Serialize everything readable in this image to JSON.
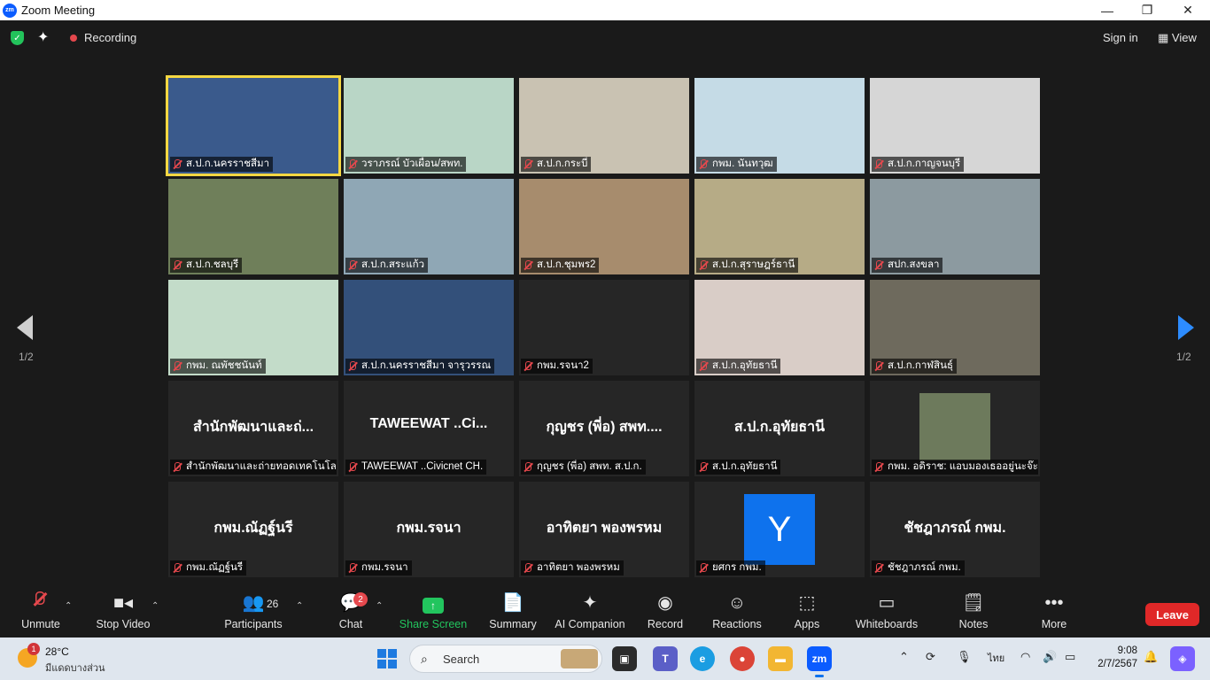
{
  "window": {
    "title": "Zoom Meeting",
    "controls": [
      "—",
      "❐",
      "✕"
    ]
  },
  "topbar": {
    "recording_label": "Recording",
    "signin_label": "Sign in",
    "view_label": "View"
  },
  "pagination": {
    "left": "1/2",
    "right": "1/2"
  },
  "tiles": [
    {
      "label": "ส.ป.ก.นครราชสีมา",
      "kind": "video",
      "bg": "#3a5a8c",
      "active": true,
      "pinned": true
    },
    {
      "label": "วราภรณ์ บัวเผื่อน/สพท.",
      "kind": "video",
      "bg": "#b9d6c6"
    },
    {
      "label": "ส.ป.ก.กระบี่",
      "kind": "video",
      "bg": "#c9c2b2"
    },
    {
      "label": "กพม. นันทวุฒ",
      "kind": "video",
      "bg": "#c5dbe6"
    },
    {
      "label": "ส.ป.ก.กาญจนบุรี",
      "kind": "video",
      "bg": "#d6d6d6"
    },
    {
      "label": "ส.ป.ก.ชลบุรี",
      "kind": "video",
      "bg": "#6f7f5a"
    },
    {
      "label": "ส.ป.ก.สระแก้ว",
      "kind": "video",
      "bg": "#8fa7b5"
    },
    {
      "label": "ส.ป.ก.ชุมพร2",
      "kind": "video",
      "bg": "#a78c6d"
    },
    {
      "label": "ส.ป.ก.สุราษฎร์ธานี",
      "kind": "video",
      "bg": "#b6ab86"
    },
    {
      "label": "สปก.สงขลา",
      "kind": "video",
      "bg": "#8c9aa0"
    },
    {
      "label": "กพม. ณพัชชนันท์",
      "kind": "video",
      "bg": "#c3dcc9"
    },
    {
      "label": "ส.ป.ก.นครราชสีมา จารุวรรณ",
      "kind": "video",
      "bg": "#33507a"
    },
    {
      "label": "กพม.รจนา2",
      "kind": "video",
      "bg": "#262626"
    },
    {
      "label": "ส.ป.ก.อุทัยธานี",
      "kind": "video",
      "bg": "#d9cdc7"
    },
    {
      "label": "ส.ป.ก.กาฬสินธุ์",
      "kind": "video",
      "bg": "#6e6a5d"
    },
    {
      "label": "สำนักพัฒนาและถ่ายทอดเทคโนโล...",
      "kind": "name",
      "name": "สำนักพัฒนาและถ่..."
    },
    {
      "label": "TAWEEWAT ..Civicnet CH.",
      "kind": "name",
      "name": "TAWEEWAT ..Ci..."
    },
    {
      "label": "กุญชร (พี่อ) สพท. ส.ป.ก.",
      "kind": "name",
      "name": "กุญชร (พี่อ) สพท...."
    },
    {
      "label": "ส.ป.ก.อุทัยธานี",
      "kind": "name",
      "name": "ส.ป.ก.อุทัยธานี"
    },
    {
      "label": "กพม. อดิราช: แอบมองเธออยู่นะจ๊ะ",
      "kind": "photo",
      "bg": "#262626"
    },
    {
      "label": "กพม.ณัฏฐ์นรี",
      "kind": "name",
      "name": "กพม.ณัฏฐ์นรี"
    },
    {
      "label": "กพม.รจนา",
      "kind": "name",
      "name": "กพม.รจนา"
    },
    {
      "label": "อาทิตยา พองพรหม",
      "kind": "name",
      "name": "อาทิตยา พองพรหม"
    },
    {
      "label": "ยศกร กพม.",
      "kind": "avatar",
      "initial": "Y"
    },
    {
      "label": "ชัชฎาภรณ์ กพม.",
      "kind": "name",
      "name": "ชัชฎาภรณ์ กพม."
    }
  ],
  "toolbar": {
    "unmute": "Unmute",
    "stop_video": "Stop Video",
    "participants": "Participants",
    "participants_count": "26",
    "chat": "Chat",
    "chat_badge": "2",
    "share_screen": "Share Screen",
    "summary": "Summary",
    "ai_companion": "AI Companion",
    "record": "Record",
    "reactions": "Reactions",
    "apps": "Apps",
    "whiteboards": "Whiteboards",
    "notes": "Notes",
    "more": "More",
    "leave": "Leave"
  },
  "taskbar": {
    "weather_badge": "1",
    "temperature": "28°C",
    "condition": "มีแดดบางส่วน",
    "search_placeholder": "Search",
    "language": "ไทย",
    "time": "9:08",
    "date": "2/7/2567"
  },
  "colors": {
    "accent": "#0b5cff",
    "share_green": "#22c55e",
    "leave_red": "#e02828",
    "active_speaker": "#f5d742"
  }
}
